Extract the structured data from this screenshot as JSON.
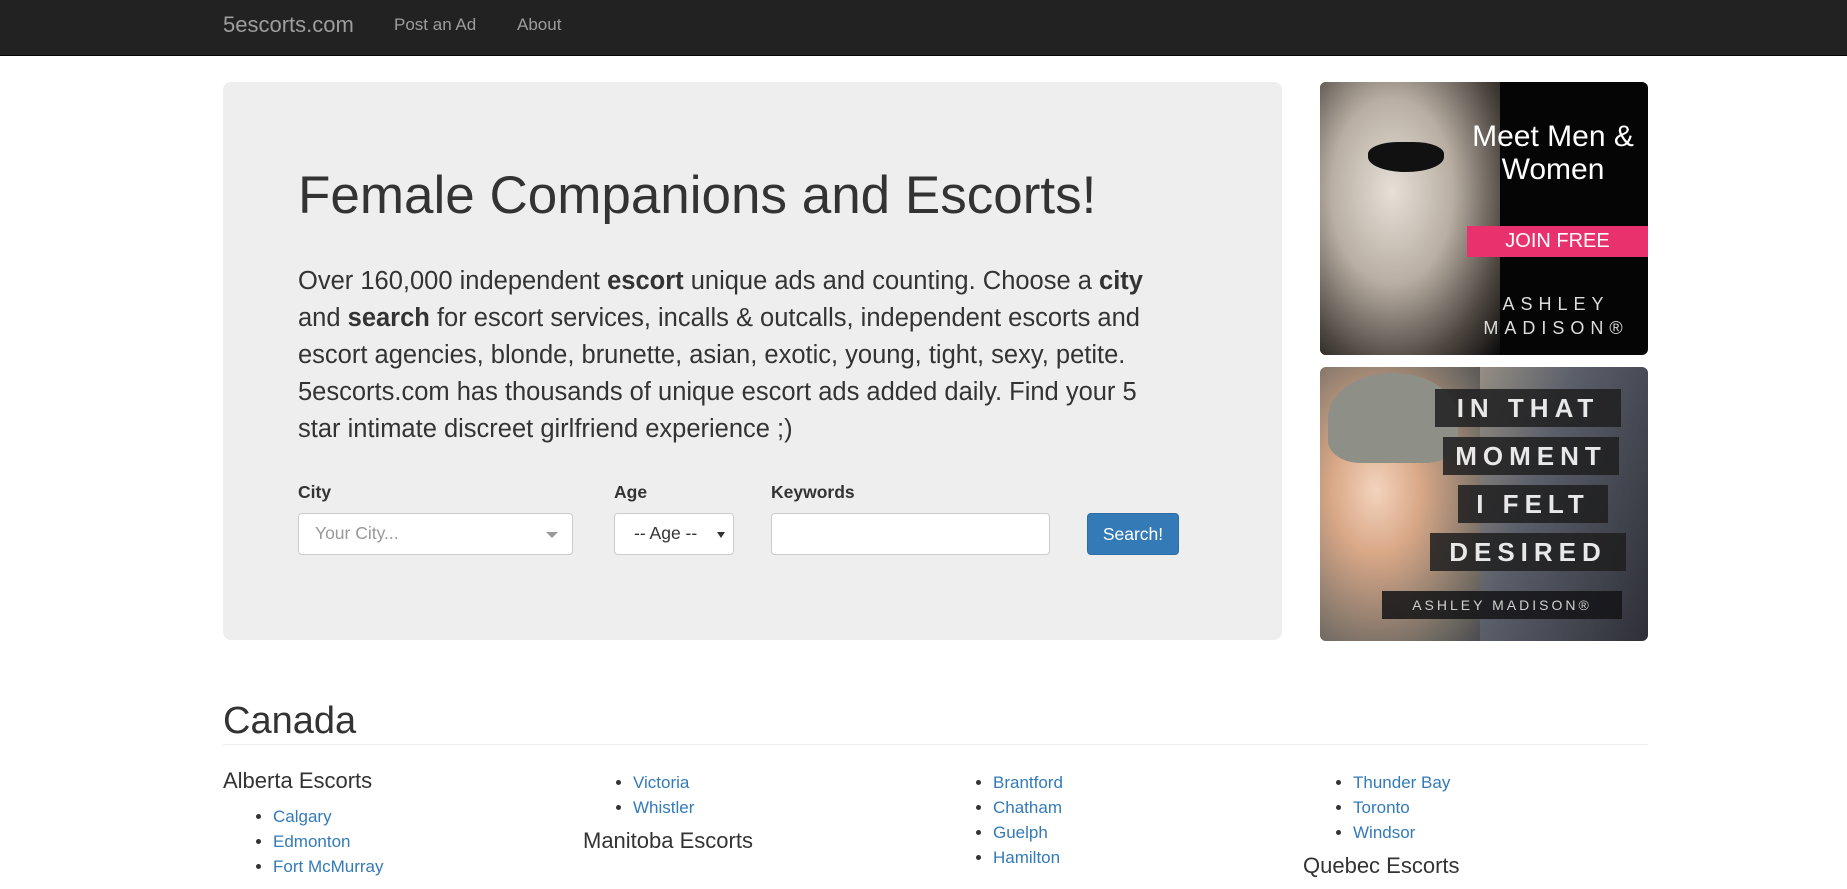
{
  "navbar": {
    "brand": "5escorts.com",
    "links": [
      "Post an Ad",
      "About"
    ]
  },
  "hero": {
    "title": "Female Companions and Escorts!",
    "desc": {
      "p1": "Over 160,000 independent ",
      "b1": "escort",
      "p2": " unique ads and counting. Choose a ",
      "b2": "city",
      "p3": " and ",
      "b3": "search",
      "p4": " for escort services, incalls & outcalls, independent escorts and escort agencies, blonde, brunette, asian, exotic, young, tight, sexy, petite. 5escorts.com has thousands of unique escort ads added daily. Find your 5 star intimate discreet girlfriend experience ;)"
    }
  },
  "search": {
    "city_label": "City",
    "city_placeholder": "Your City...",
    "age_label": "Age",
    "age_value": "-- Age --",
    "keywords_label": "Keywords",
    "keywords_value": "",
    "button_label": "Search!"
  },
  "ads": {
    "ad1": {
      "headline": "Meet Men & Women",
      "cta": "JOIN FREE",
      "brand": "ASHLEY MADISON®"
    },
    "ad2": {
      "lines": [
        "IN THAT",
        "MOMENT",
        "I FELT",
        "DESIRED"
      ],
      "brand": "ASHLEY MADISON®"
    }
  },
  "listings": {
    "country": "Canada",
    "columns": [
      {
        "heading": "Alberta Escorts",
        "cities": [
          "Calgary",
          "Edmonton",
          "Fort McMurray"
        ]
      },
      {
        "cities": [
          "Victoria",
          "Whistler"
        ],
        "next_heading": "Manitoba Escorts"
      },
      {
        "cities": [
          "Brantford",
          "Chatham",
          "Guelph",
          "Hamilton"
        ]
      },
      {
        "cities": [
          "Thunder Bay",
          "Toronto",
          "Windsor"
        ],
        "next_heading": "Quebec Escorts"
      }
    ]
  }
}
